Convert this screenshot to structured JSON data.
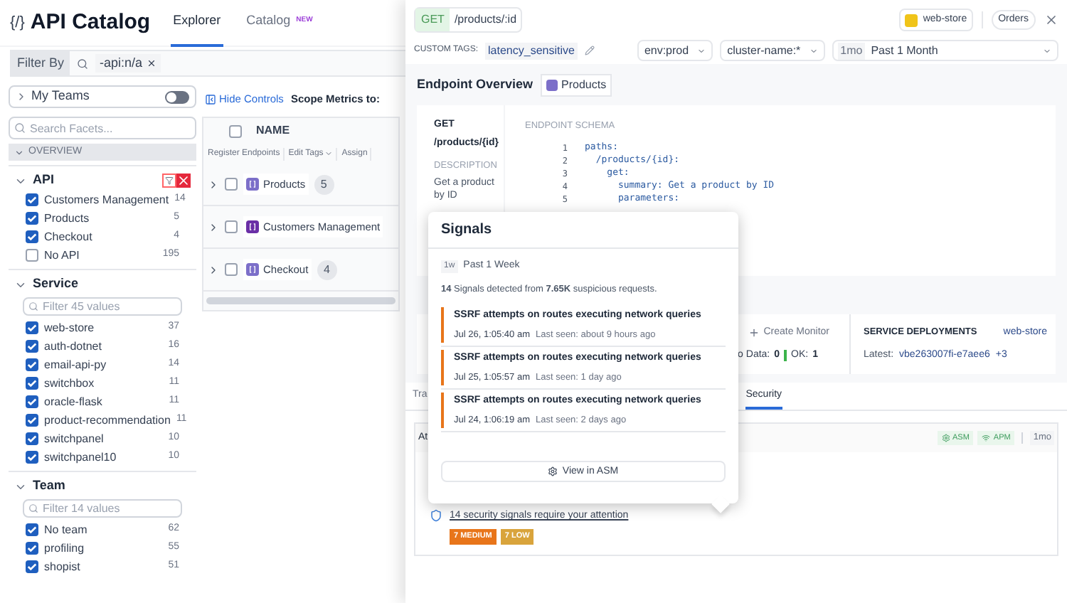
{
  "header": {
    "logo": "{/}",
    "title": "API Catalog",
    "tabs": [
      {
        "label": "Explorer",
        "selected": true
      },
      {
        "label": "Catalog",
        "selected": false,
        "badge": "NEW"
      }
    ]
  },
  "filter_bar": {
    "label": "Filter By",
    "chips": [
      "-api:n/a"
    ]
  },
  "sidebar": {
    "my_teams": {
      "label": "My Teams",
      "on": false
    },
    "search": {
      "placeholder": "Search Facets..."
    },
    "section": "OVERVIEW",
    "facets": [
      {
        "title": "API",
        "kind": "toggleable",
        "items": [
          {
            "label": "Customers Management",
            "count": "14",
            "checked": true
          },
          {
            "label": "Products",
            "count": "5",
            "checked": true
          },
          {
            "label": "Checkout",
            "count": "4",
            "checked": true
          },
          {
            "label": "No API",
            "count": "195",
            "checked": false
          }
        ]
      },
      {
        "title": "Service",
        "kind": "searchable",
        "placeholder": "Filter 45 values",
        "items": [
          {
            "label": "web-store",
            "count": "37",
            "checked": true
          },
          {
            "label": "auth-dotnet",
            "count": "16",
            "checked": true
          },
          {
            "label": "email-api-py",
            "count": "14",
            "checked": true
          },
          {
            "label": "switchbox",
            "count": "11",
            "checked": true
          },
          {
            "label": "oracle-flask",
            "count": "11",
            "checked": true
          },
          {
            "label": "product-recommendation",
            "count": "11",
            "checked": true
          },
          {
            "label": "switchpanel",
            "count": "10",
            "checked": true
          },
          {
            "label": "switchpanel10",
            "count": "10",
            "checked": true
          }
        ]
      },
      {
        "title": "Team",
        "kind": "searchable",
        "placeholder": "Filter 14 values",
        "items": [
          {
            "label": "No team",
            "count": "62",
            "checked": true
          },
          {
            "label": "profiling",
            "count": "55",
            "checked": true
          },
          {
            "label": "shopist",
            "count": "51",
            "checked": true
          }
        ]
      }
    ]
  },
  "main": {
    "hide_controls": "Hide Controls",
    "scope_label": "Scope Metrics to:",
    "column": "NAME",
    "all_checked": false,
    "actions": [
      "Register Endpoints",
      "Edit Tags",
      "Assign"
    ],
    "rows": [
      {
        "name": "Products",
        "count": "5",
        "color": "#7c6fc9",
        "checked": false
      },
      {
        "name": "Customers Management",
        "color": "#6a2fa6",
        "checked": false
      },
      {
        "name": "Checkout",
        "count": "4",
        "color": "#7c6fc9",
        "checked": false
      }
    ]
  },
  "drawer": {
    "method": "GET",
    "path": "/products/:id",
    "service": "web-store",
    "team": "Orders",
    "custom_tags_label": "CUSTOM TAGS:",
    "tags": [
      "latency_sensitive"
    ],
    "selectors": [
      "env:prod",
      "cluster-name:*"
    ],
    "time": {
      "short": "1mo",
      "label": "Past 1 Month"
    },
    "overview_title": "Endpoint Overview",
    "api_tag": "Products",
    "endpoint": {
      "method": "GET",
      "path": "/products/{id}",
      "description_label": "DESCRIPTION",
      "description": "Get a product by ID"
    },
    "schema": {
      "title": "ENDPOINT SCHEMA",
      "lines": [
        {
          "number": "1",
          "code": "paths:"
        },
        {
          "number": "2",
          "code": "  /products/{id}:"
        },
        {
          "number": "3",
          "code": "    get:"
        },
        {
          "number": "4",
          "code": "      summary: Get a product by ID"
        },
        {
          "number": "5",
          "code": "      parameters:"
        }
      ]
    },
    "monitors": {
      "create": "Create Monitor",
      "no_data_label": "o Data:",
      "no_data": "0",
      "ok_label": "OK:",
      "ok": "1"
    },
    "deployments": {
      "title": "SERVICE DEPLOYMENTS",
      "service": "web-store",
      "latest_label": "Latest:",
      "version": "vbe263007fi-e7aee6",
      "more": "+3"
    },
    "tabs": [
      {
        "label": "Tra",
        "selected": false
      },
      {
        "label": "Security",
        "selected": true
      }
    ],
    "security": {
      "title": "At",
      "badges": [
        "ASM",
        "APM"
      ],
      "range": "1mo",
      "summary": "14 security signals require your attention",
      "severities": [
        {
          "label": "7 MEDIUM",
          "color": "#e8751a"
        },
        {
          "label": "7 LOW",
          "color": "#d9a43c"
        }
      ]
    }
  },
  "popover": {
    "title": "Signals",
    "range_short": "1w",
    "range": "Past 1 Week",
    "summary": "**14** Signals detected from **7.65K** suspicious requests.",
    "signals": [
      {
        "title": "SSRF attempts on routes executing network queries",
        "date": "Jul 26, 1:05:40 am",
        "last_seen": "Last seen: about 9 hours ago"
      },
      {
        "title": "SSRF attempts on routes executing network queries",
        "date": "Jul 25, 1:05:57 am",
        "last_seen": "Last seen: 1 day ago"
      },
      {
        "title": "SSRF attempts on routes executing network queries",
        "date": "Jul 24, 1:06:19 am",
        "last_seen": "Last seen: 2 days ago"
      }
    ],
    "button": "View in ASM"
  }
}
